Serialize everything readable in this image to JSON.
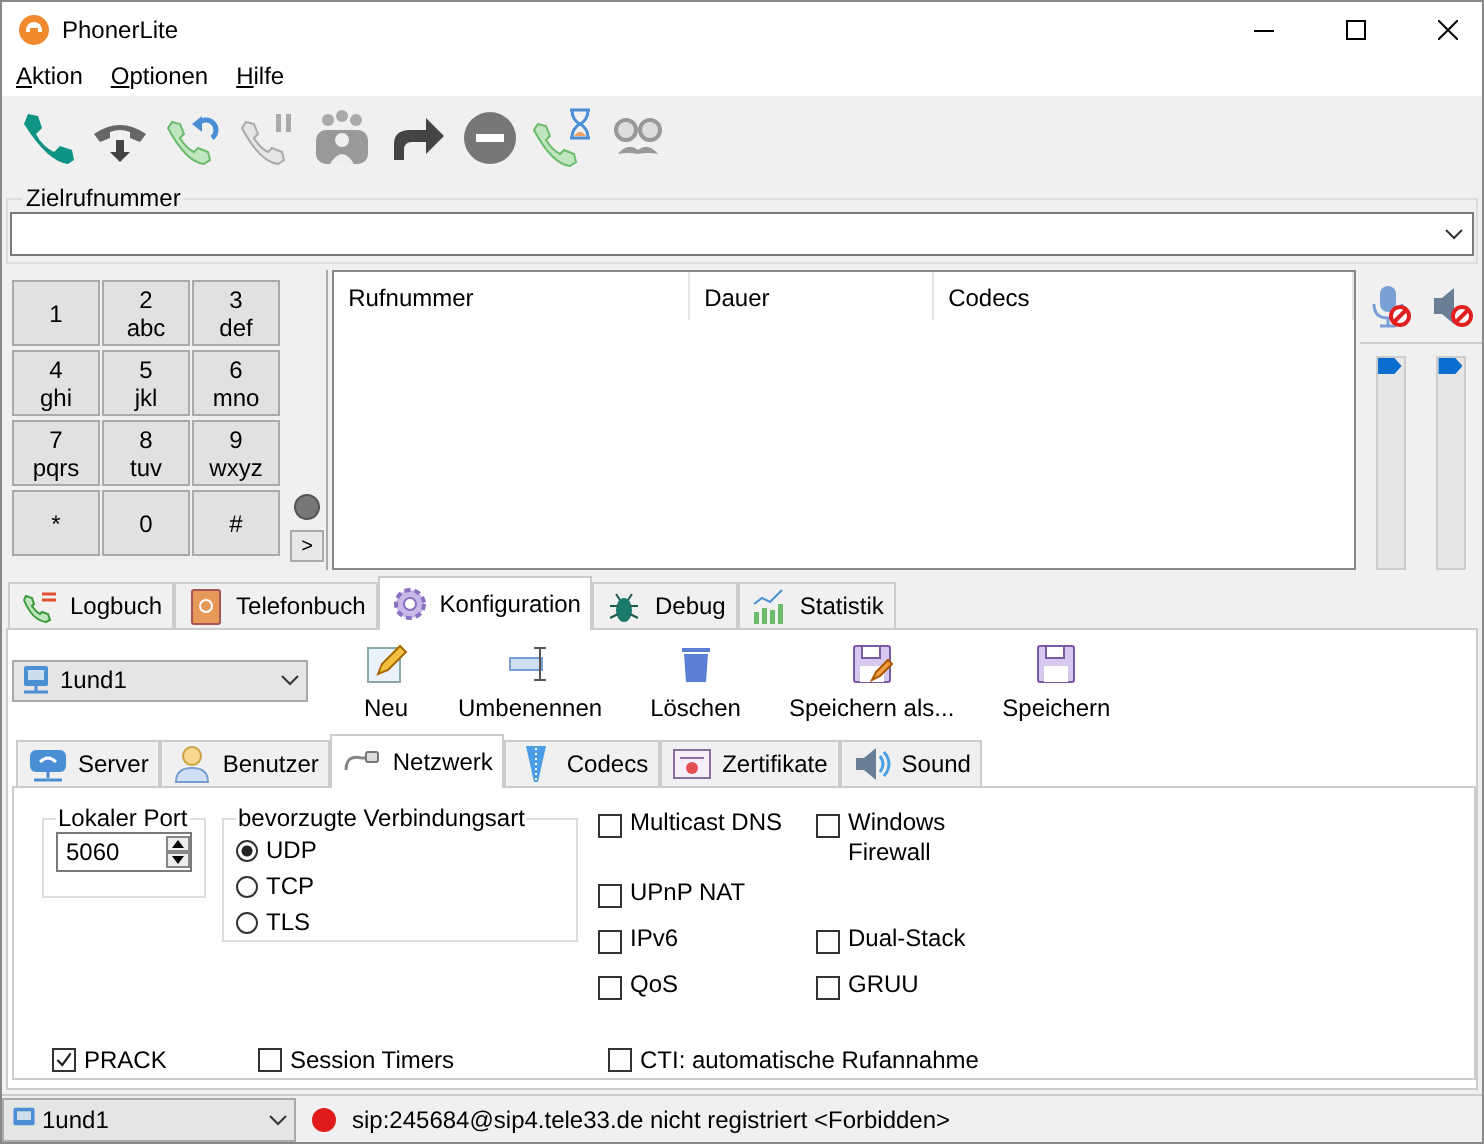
{
  "window": {
    "title": "PhonerLite"
  },
  "menu": [
    {
      "label": "Aktion"
    },
    {
      "label": "Optionen"
    },
    {
      "label": "Hilfe"
    }
  ],
  "destination": {
    "label": "Zielrufnummer"
  },
  "keypad": [
    {
      "digit": "1"
    },
    {
      "digit": "2",
      "letters": "abc"
    },
    {
      "digit": "3",
      "letters": "def"
    },
    {
      "digit": "4",
      "letters": "ghi"
    },
    {
      "digit": "5",
      "letters": "jkl"
    },
    {
      "digit": "6",
      "letters": "mno"
    },
    {
      "digit": "7",
      "letters": "pqrs"
    },
    {
      "digit": "8",
      "letters": "tuv"
    },
    {
      "digit": "9",
      "letters": "wxyz"
    },
    {
      "digit": "*"
    },
    {
      "digit": "0"
    },
    {
      "digit": "#"
    }
  ],
  "expand_button": ">",
  "calls_table": {
    "columns": [
      "Rufnummer",
      "Dauer",
      "Codecs"
    ]
  },
  "volume": [
    {
      "kind": "microphone",
      "muted": true,
      "level": 1
    },
    {
      "kind": "speaker",
      "muted": true,
      "level": 1
    }
  ],
  "tabs": [
    {
      "label": "Logbuch",
      "selected": false
    },
    {
      "label": "Telefonbuch",
      "selected": false
    },
    {
      "label": "Konfiguration",
      "selected": true
    },
    {
      "label": "Debug",
      "selected": false
    },
    {
      "label": "Statistik",
      "selected": false
    }
  ],
  "profile": "1und1",
  "actions": [
    {
      "label": "Neu"
    },
    {
      "label": "Umbenennen"
    },
    {
      "label": "Löschen"
    },
    {
      "label": "Speichern als..."
    },
    {
      "label": "Speichern"
    }
  ],
  "subtabs": [
    {
      "label": "Server",
      "selected": false
    },
    {
      "label": "Benutzer",
      "selected": false
    },
    {
      "label": "Netzwerk",
      "selected": true
    },
    {
      "label": "Codecs",
      "selected": false
    },
    {
      "label": "Zertifikate",
      "selected": false
    },
    {
      "label": "Sound",
      "selected": false
    }
  ],
  "local_port": {
    "label": "Lokaler Port",
    "value": "5060"
  },
  "transport": {
    "label": "bevorzugte Verbindungsart",
    "options": [
      {
        "label": "UDP",
        "selected": true
      },
      {
        "label": "TCP",
        "selected": false
      },
      {
        "label": "TLS",
        "selected": false
      }
    ]
  },
  "option_rows": [
    [
      {
        "label": "Multicast DNS",
        "checked": false
      },
      {
        "label": "Windows Firewall",
        "checked": false
      }
    ],
    [
      {
        "label": "UPnP NAT",
        "checked": false
      }
    ],
    [
      {
        "label": "IPv6",
        "checked": false
      },
      {
        "label": "Dual-Stack",
        "checked": false
      }
    ],
    [
      {
        "label": "QoS",
        "checked": false
      },
      {
        "label": "GRUU",
        "checked": false
      }
    ]
  ],
  "bottom_options": [
    {
      "label": "PRACK",
      "checked": true
    },
    {
      "label": "Session Timers",
      "checked": false
    },
    {
      "label": "CTI: automatische Rufannahme",
      "checked": false
    }
  ],
  "status_bar": {
    "profile": "1und1",
    "registered": false,
    "message": "sip:245684@sip4.tele33.de nicht registriert <Forbidden>"
  }
}
